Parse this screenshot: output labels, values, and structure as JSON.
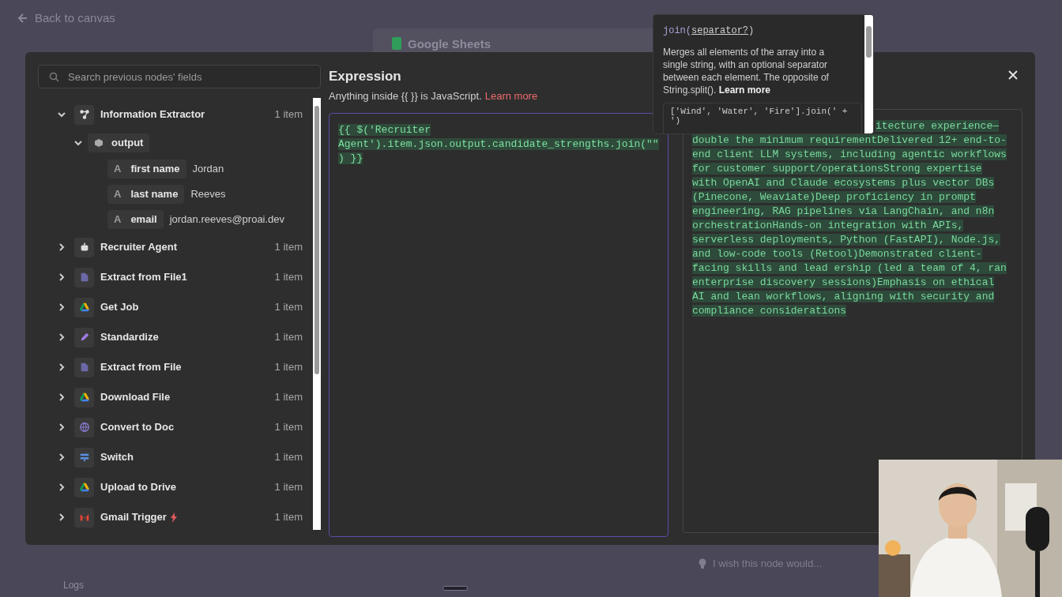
{
  "back_link": "Back to canvas",
  "background": {
    "node_title": "Google Sheets",
    "feedback_placeholder": "I wish this node would...",
    "logs_label": "Logs"
  },
  "search": {
    "placeholder": "Search previous nodes' fields"
  },
  "tree": [
    {
      "kind": "extractor",
      "label": "Information Extractor",
      "count": "1 item",
      "expanded": true,
      "trigger": false,
      "children": [
        {
          "kind": "object",
          "label": "output",
          "expanded": true,
          "children": [
            {
              "kind": "string",
              "type_glyph": "A",
              "label": "first name",
              "value": "Jordan"
            },
            {
              "kind": "string",
              "type_glyph": "A",
              "label": "last name",
              "value": "Reeves"
            },
            {
              "kind": "string",
              "type_glyph": "A",
              "label": "email",
              "value": "jordan.reeves@proai.dev"
            }
          ]
        }
      ]
    },
    {
      "kind": "robot",
      "label": "Recruiter Agent",
      "count": "1 item",
      "expanded": false,
      "trigger": false
    },
    {
      "kind": "file",
      "label": "Extract from File1",
      "count": "1 item",
      "expanded": false,
      "trigger": false
    },
    {
      "kind": "drive",
      "label": "Get Job",
      "count": "1 item",
      "expanded": false,
      "trigger": false
    },
    {
      "kind": "pencil",
      "label": "Standardize",
      "count": "1 item",
      "expanded": false,
      "trigger": false
    },
    {
      "kind": "file",
      "label": "Extract from File",
      "count": "1 item",
      "expanded": false,
      "trigger": false
    },
    {
      "kind": "drive",
      "label": "Download File",
      "count": "1 item",
      "expanded": false,
      "trigger": false
    },
    {
      "kind": "globe",
      "label": "Convert to Doc",
      "count": "1 item",
      "expanded": false,
      "trigger": false
    },
    {
      "kind": "switch",
      "label": "Switch",
      "count": "1 item",
      "expanded": false,
      "trigger": false
    },
    {
      "kind": "drive",
      "label": "Upload to Drive",
      "count": "1 item",
      "expanded": false,
      "trigger": false
    },
    {
      "kind": "gmail",
      "label": "Gmail Trigger",
      "count": "1 item",
      "expanded": false,
      "trigger": true
    }
  ],
  "expression": {
    "title": "Expression",
    "hint": "Anything inside {{  }} is JavaScript.",
    "hint_link": "Learn more",
    "code_lines": [
      "{{ $('Recruiter",
      "Agent').item.json.output.candidate_strengths.join(\"\"",
      ") }}"
    ]
  },
  "result_lines": [
    "itecture experience—",
    "double the minimum requirementDelivered 12+ end-to-",
    "end client LLM systems, including agentic workflows",
    "for customer support/operationsStrong expertise",
    "with OpenAI and Claude ecosystems plus vector DBs",
    "(Pinecone, Weaviate)Deep proficiency in prompt",
    "engineering, RAG pipelines via LangChain, and n8n",
    "orchestrationHands-on integration with APIs,",
    "serverless deployments, Python (FastAPI), Node.js,",
    "and low-code tools (Retool)Demonstrated client-",
    "facing skills and lead ership (led a team of 4, ran",
    "enterprise discovery sessions)Emphasis on ethical",
    "AI and lean workflows, aligning with security and",
    "compliance considerations"
  ],
  "tooltip": {
    "signature_name": "join(",
    "signature_param": "separator?",
    "signature_close": ")",
    "description": "Merges all elements of the array into a single string, with an optional separator between each element. The opposite of String.split().",
    "link": "Learn more",
    "example_lines": [
      "['Wind', 'Water', 'Fire'].join(' +",
      "')"
    ]
  }
}
